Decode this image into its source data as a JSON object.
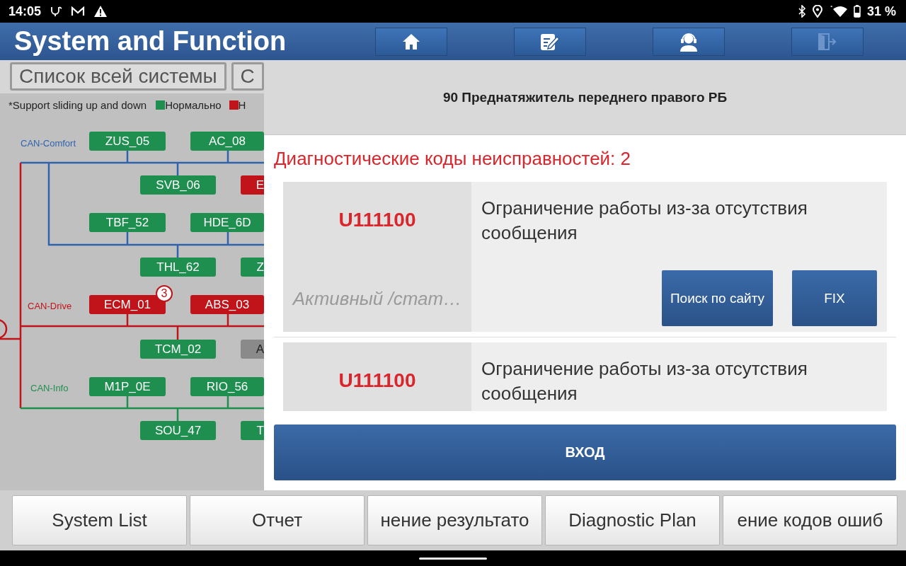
{
  "status_bar": {
    "time": "14:05",
    "battery": "31 %"
  },
  "header": {
    "title": "System and Function",
    "buttons": [
      {
        "kind": "home",
        "disabled": false
      },
      {
        "kind": "edit",
        "disabled": false
      },
      {
        "kind": "support",
        "disabled": false
      },
      {
        "kind": "exit",
        "disabled": true
      }
    ]
  },
  "system_tabs": [
    {
      "label": "Список всей системы"
    },
    {
      "label": "С"
    }
  ],
  "legend": {
    "note": "*Support sliding up and down",
    "items": [
      {
        "label": "Нормально",
        "color": "#1e8f4e"
      },
      {
        "label": "Н",
        "color": "#c0141a"
      }
    ]
  },
  "topology": {
    "buses": [
      {
        "label": "CAN-Comfort",
        "color": "#2f63ad"
      },
      {
        "label": "CAN-Drive",
        "color": "#c0141a"
      },
      {
        "label": "CAN-Info",
        "color": "#1e8f4e"
      }
    ],
    "nodes": [
      {
        "label": "ZUS_05",
        "color": "#1e8f4e"
      },
      {
        "label": "AC_08",
        "color": "#1e8f4e"
      },
      {
        "label": "SVB_06",
        "color": "#1e8f4e"
      },
      {
        "label": "E",
        "color": "#c0141a"
      },
      {
        "label": "TBF_52",
        "color": "#1e8f4e"
      },
      {
        "label": "HDE_6D",
        "color": "#1e8f4e"
      },
      {
        "label": "THL_62",
        "color": "#1e8f4e"
      },
      {
        "label": "Z",
        "color": "#1e8f4e"
      },
      {
        "label": "ECM_01",
        "color": "#c0141a",
        "badge": "3"
      },
      {
        "label": "ABS_03",
        "color": "#c0141a"
      },
      {
        "label": "TCM_02",
        "color": "#1e8f4e"
      },
      {
        "label": "A",
        "color": "#8a8a8a"
      },
      {
        "label": "M1P_0E",
        "color": "#1e8f4e"
      },
      {
        "label": "RIO_56",
        "color": "#1e8f4e"
      },
      {
        "label": "SOU_47",
        "color": "#1e8f4e"
      },
      {
        "label": "T",
        "color": "#1e8f4e"
      }
    ]
  },
  "dialog": {
    "title": "90 Преднатяжитель переднего правого РБ",
    "heading": "Диагностические коды неисправностей: 2",
    "codes": [
      {
        "code": "U111100",
        "description": "Ограничение работы из-за отсутствия сообщения",
        "status": "Активный /стат…",
        "buttons": [
          "Поиск по сайту",
          "FIX"
        ]
      },
      {
        "code": "U111100",
        "description": "Ограничение работы из-за отсутствия сообщения"
      }
    ],
    "enter_button": "ВХОД"
  },
  "bottom_buttons": [
    "System List",
    "Отчет",
    "нение результато",
    "Diagnostic Plan",
    "ение кодов ошиб"
  ]
}
